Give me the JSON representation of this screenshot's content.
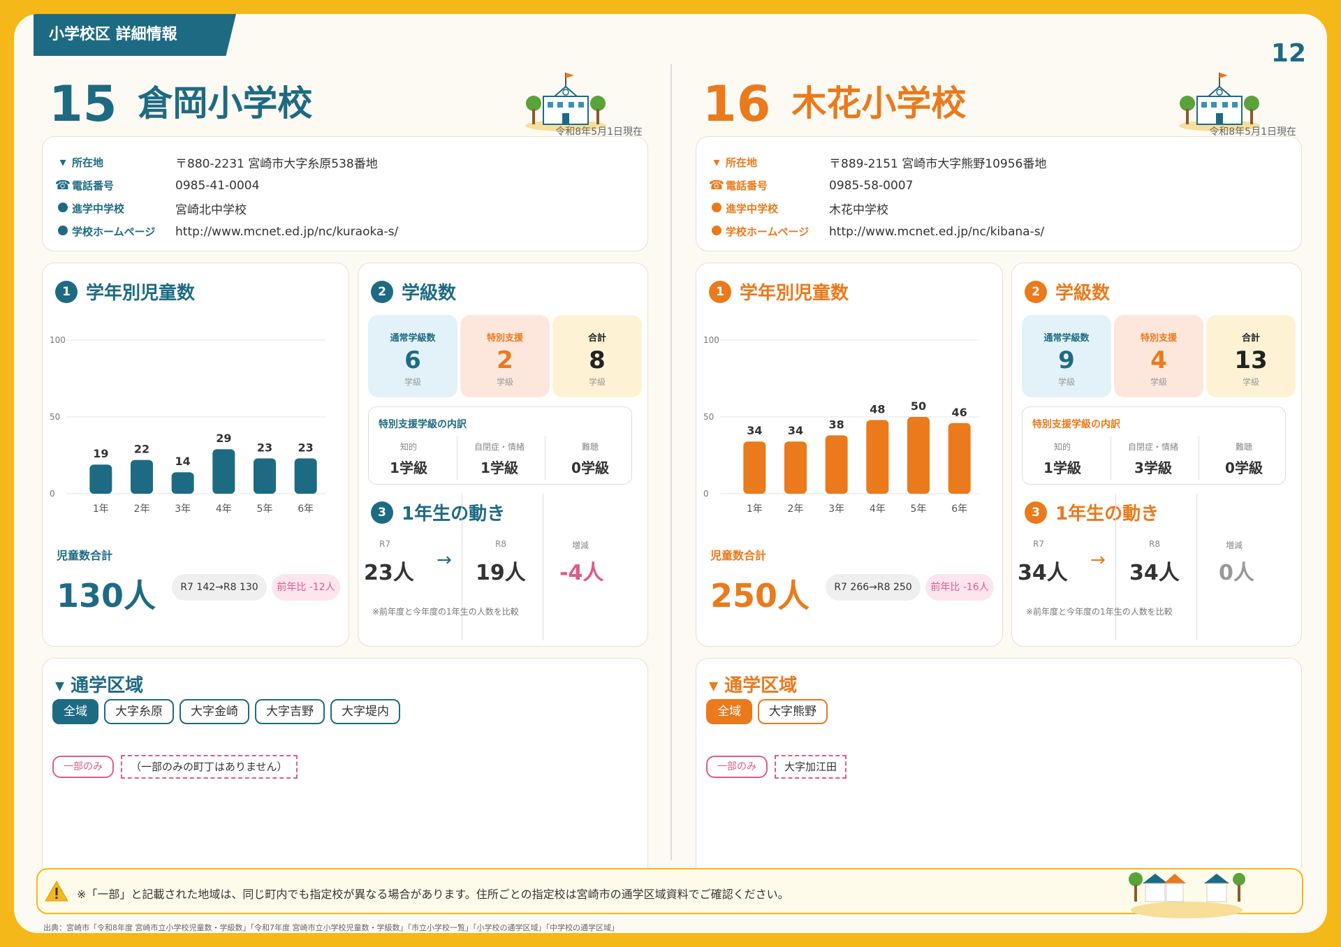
{
  "header": {
    "section": "小学校区 詳細情報",
    "page_number": "12"
  },
  "common": {
    "as_of": "令和8年5月1日現在",
    "info_labels": {
      "address": "所在地",
      "phone": "電話番号",
      "middle": "進学中学校",
      "homepage": "学校ホームページ"
    },
    "sec1_title": "学年別児童数",
    "sec2_title": "学級数",
    "sec3_title": "1年生の動き",
    "total_label": "児童数合計",
    "class_labels": {
      "regular": "通常学級数",
      "special": "特別支援",
      "total": "合計",
      "unit": "学級"
    },
    "breakdown_title": "特別支援学級の内訳",
    "breakdown_labels": {
      "intellectual": "知的",
      "autism": "自閉症・情緒",
      "hearing": "難聴"
    },
    "move_labels": {
      "r7": "R7",
      "r8": "R8",
      "change": "増減"
    },
    "move_note": "※前年度と今年度の1年生の人数を比較",
    "area_title": "通学区域",
    "partial_label": "一部のみ",
    "y_ticks": [
      "100",
      "50",
      "0"
    ]
  },
  "schools": [
    {
      "number": "15",
      "name": "倉岡小学校",
      "address": "〒880-2231 宮崎市大字糸原538番地",
      "phone": "0985-41-0004",
      "middle_school": "宮崎北中学校",
      "homepage": "http://www.mcnet.ed.jp/nc/kuraoka-s/",
      "total_students": "130人",
      "compare": "R7 142→R8 130",
      "diff": "前年比 -12人",
      "classes": {
        "regular": "6",
        "special": "2",
        "total": "8"
      },
      "breakdown": {
        "intellectual": "1学級",
        "autism": "1学級",
        "hearing": "0学級"
      },
      "move": {
        "r7": "23人",
        "r8": "19人",
        "change": "-4人"
      },
      "area_chips": [
        "全域",
        "大字糸原",
        "大字金崎",
        "大字吉野",
        "大字堤内"
      ],
      "partial": "（一部のみの町丁はありません）"
    },
    {
      "number": "16",
      "name": "木花小学校",
      "address": "〒889-2151 宮崎市大字熊野10956番地",
      "phone": "0985-58-0007",
      "middle_school": "木花中学校",
      "homepage": "http://www.mcnet.ed.jp/nc/kibana-s/",
      "total_students": "250人",
      "compare": "R7 266→R8 250",
      "diff": "前年比 -16人",
      "classes": {
        "regular": "9",
        "special": "4",
        "total": "13"
      },
      "breakdown": {
        "intellectual": "1学級",
        "autism": "3学級",
        "hearing": "0学級"
      },
      "move": {
        "r7": "34人",
        "r8": "34人",
        "change": "0人"
      },
      "area_chips": [
        "全域",
        "大字熊野"
      ],
      "partial": "大字加江田"
    }
  ],
  "chart_data": [
    {
      "type": "bar",
      "categories": [
        "1年",
        "2年",
        "3年",
        "4年",
        "5年",
        "6年"
      ],
      "values": [
        19,
        22,
        14,
        29,
        23,
        23
      ],
      "ylim": [
        0,
        100
      ],
      "yticks": [
        0,
        50,
        100
      ],
      "color": "#1d6b83"
    },
    {
      "type": "bar",
      "categories": [
        "1年",
        "2年",
        "3年",
        "4年",
        "5年",
        "6年"
      ],
      "values": [
        34,
        34,
        38,
        48,
        50,
        46
      ],
      "ylim": [
        0,
        100
      ],
      "yticks": [
        0,
        50,
        100
      ],
      "color": "#ea7a1c"
    }
  ],
  "colors": {
    "teal": "#1d6b83",
    "orange": "#ea7a1c",
    "yellow": "#f5b819",
    "pink": "#e05a8a"
  },
  "footer": {
    "warning": "※「一部」と記載された地域は、同じ町内でも指定校が異なる場合があります。住所ごとの指定校は宮崎市の通学区域資料でご確認ください。",
    "source": "出典：宮崎市「令和8年度 宮崎市立小学校児童数・学級数」「令和7年度 宮崎市立小学校児童数・学級数」「市立小学校一覧」「小学校の通学区域」「中学校の通学区域」"
  }
}
